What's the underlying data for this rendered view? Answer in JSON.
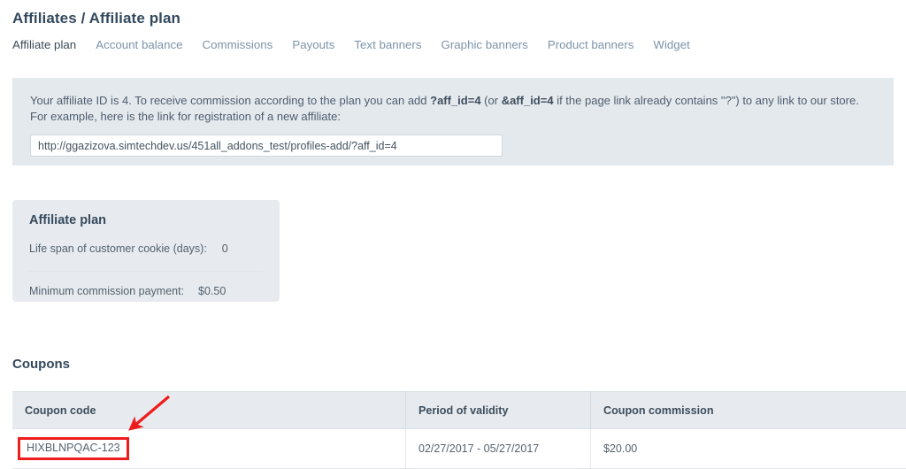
{
  "header": {
    "title": "Affiliates / Affiliate plan"
  },
  "tabs": [
    {
      "label": "Affiliate plan",
      "active": true
    },
    {
      "label": "Account balance",
      "active": false
    },
    {
      "label": "Commissions",
      "active": false
    },
    {
      "label": "Payouts",
      "active": false
    },
    {
      "label": "Text banners",
      "active": false
    },
    {
      "label": "Graphic banners",
      "active": false
    },
    {
      "label": "Product banners",
      "active": false
    },
    {
      "label": "Widget",
      "active": false
    }
  ],
  "notice": {
    "text_part1": "Your affiliate ID is 4. To receive commission according to the plan you can add ",
    "code1": "?aff_id=4",
    "text_part2": " (or ",
    "code2": "&aff_id=4",
    "text_part3": " if the page link already contains \"?\") to any link to our store. For example, here is the link for registration of a new affiliate:",
    "affiliate_link": "http://ggazizova.simtechdev.us/451all_addons_test/profiles-add/?aff_id=4"
  },
  "plan_card": {
    "title": "Affiliate plan",
    "rows": [
      {
        "label": "Life span of customer cookie (days):",
        "value": "0"
      },
      {
        "label": "Minimum commission payment:",
        "value": "$0.50"
      }
    ]
  },
  "coupons": {
    "section_title": "Coupons",
    "columns": [
      "Coupon code",
      "Period of validity",
      "Coupon commission"
    ],
    "rows": [
      {
        "code": "HIXBLNPQAC-123",
        "period": "02/27/2017 - 05/27/2017",
        "commission": "$20.00"
      }
    ]
  },
  "annotation": {
    "arrow_color": "#ee1c1c",
    "highlight_color": "#ee1c1c"
  },
  "colors": {
    "title": "#34495e",
    "notice_bg": "#e4e9ee",
    "card_bg": "#e7ebef",
    "table_header_bg": "#e7ebef",
    "tab_inactive": "#7d93a8",
    "tab_active": "#3c4b58"
  }
}
